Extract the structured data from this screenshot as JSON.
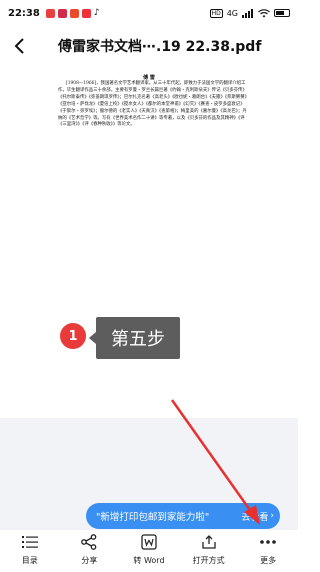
{
  "status_bar": {
    "time": "22:38",
    "network_label": "4G",
    "app_icon_colors": [
      "#e94040",
      "#d22a4a",
      "#e84a2a",
      "#f0303a",
      "#111111"
    ]
  },
  "header": {
    "title": "傅雷家书文档⋯.19 22.38.pdf"
  },
  "document": {
    "heading": "傅 雷",
    "body": "[1908—1966]，我国著名文学艺术翻译家。从三十年代起，即致力于法国文学的翻译介绍工作，毕生翻译作品三十余部，主要有罗曼・罗兰长篇巨著《约翰・克利斯朵夫》传记《贝多芬传》《托尔斯泰传》《弥盖朗琪罗传》；巴尔扎克名著《高老头》《欧也妮・葛朗台》《夫雍》《邦斯舅舅》《亚尔培・萨伐龙》《夏倍上校》《搅水女人》《都尔的本堂神甫》《幻灭》《赛查・皮罗多盛衰记》《于絮尔・弥罗埃》；服尔德的《老实人》《天真汉》《查第格》；梅里美的《嘉尔曼》《高龙巴》；丹纳的《艺术哲学》等。写有《世界美术名作二十讲》等专著，以及《贝多芬的作品及其精神》《评《三里湾》》《评《春种秋收》》等论文。"
  },
  "tutorial": {
    "step_number": "1",
    "step_text": "第五步"
  },
  "banner": {
    "text": "\"新增打印包邮到家能力啦\"",
    "action": "去看看"
  },
  "toolbar": {
    "items": [
      {
        "label": "目录",
        "icon": "list-icon"
      },
      {
        "label": "分享",
        "icon": "share-icon"
      },
      {
        "label": "转 Word",
        "icon": "word-icon"
      },
      {
        "label": "打开方式",
        "icon": "open-with-icon"
      },
      {
        "label": "更多",
        "icon": "more-icon"
      }
    ]
  },
  "colors": {
    "accent_blue": "#3a8ff3",
    "step_red": "#ea3b3b",
    "bubble_grey": "#5d5d5d",
    "arrow_red": "#e8312f"
  }
}
